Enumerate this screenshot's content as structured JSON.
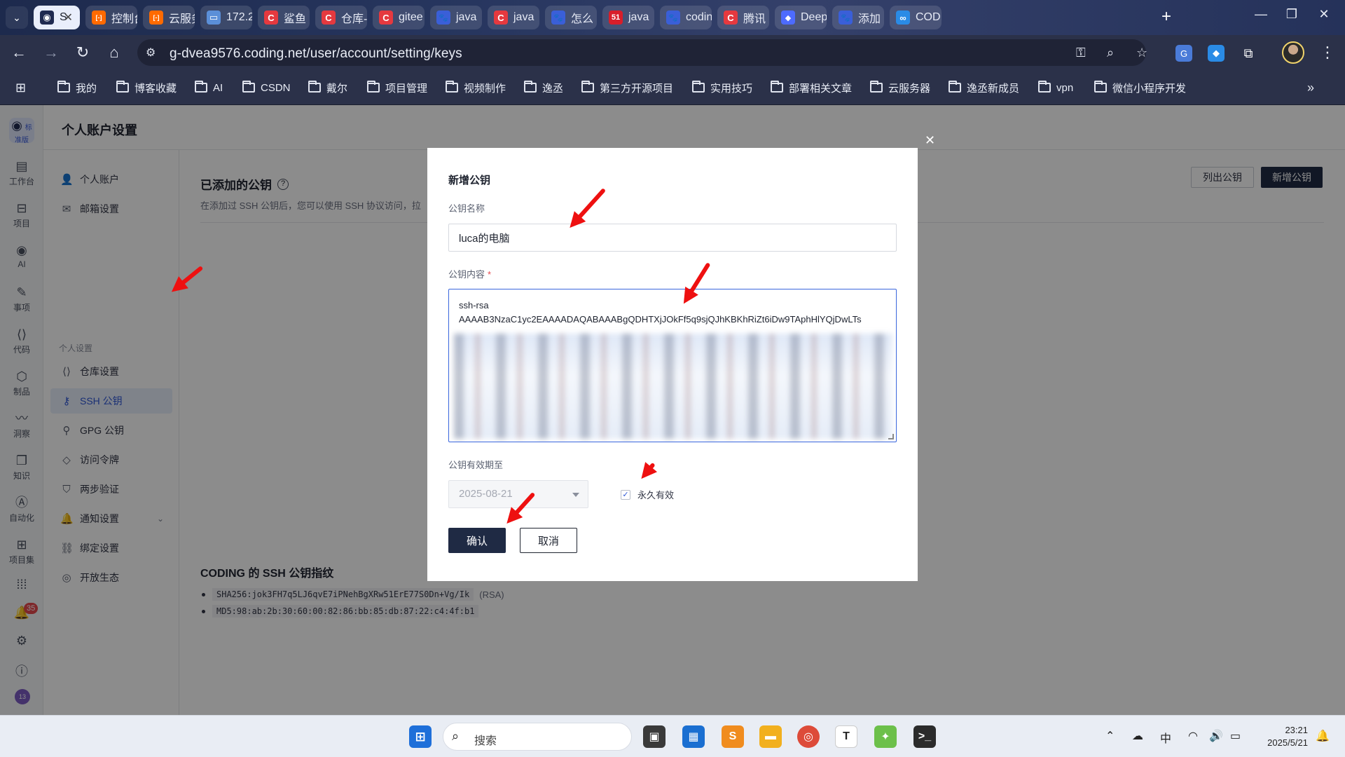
{
  "browser": {
    "tabs": [
      {
        "label": "S",
        "active": true,
        "icon_text": "",
        "icon_color": "#1f2a50"
      },
      {
        "label": "控制台",
        "icon_text": "[-]",
        "icon_color": "#ff6a00"
      },
      {
        "label": "云服务",
        "icon_text": "[-]",
        "icon_color": "#ff6a00"
      },
      {
        "label": "172.2",
        "icon_text": "▭",
        "icon_color": "#5b8fd8"
      },
      {
        "label": "鲨鱼",
        "icon_text": "C",
        "icon_color": "#e5393f"
      },
      {
        "label": "仓库-",
        "icon_text": "C",
        "icon_color": "#e5393f"
      },
      {
        "label": "gitee",
        "icon_text": "C",
        "icon_color": "#e5393f"
      },
      {
        "label": "java",
        "icon_text": "🐾",
        "icon_color": "#3a5fd8"
      },
      {
        "label": "java",
        "icon_text": "C",
        "icon_color": "#e5393f"
      },
      {
        "label": "怎么",
        "icon_text": "🐾",
        "icon_color": "#3a5fd8"
      },
      {
        "label": "java",
        "icon_text": "51",
        "icon_color": "#d81e2a"
      },
      {
        "label": "codin",
        "icon_text": "🐾",
        "icon_color": "#3a5fd8"
      },
      {
        "label": "腾讯",
        "icon_text": "C",
        "icon_color": "#e5393f"
      },
      {
        "label": "Deep",
        "icon_text": "◆",
        "icon_color": "#4d6bfe"
      },
      {
        "label": "添加",
        "icon_text": "🐾",
        "icon_color": "#3a5fd8"
      },
      {
        "label": "CODI",
        "icon_text": "∞",
        "icon_color": "#2a8be6"
      }
    ],
    "url": "g-dvea9576.coding.net/user/account/setting/keys",
    "bookmarks": [
      "我的",
      "博客收藏",
      "AI",
      "CSDN",
      "戴尔",
      "项目管理",
      "视频制作",
      "逸丞",
      "第三方开源项目",
      "实用技巧",
      "部署相关文章",
      "云服务器",
      "逸丞新成员",
      "vpn",
      "微信小程序开发"
    ]
  },
  "rail": {
    "logo_label": "标准版",
    "items": [
      {
        "label": "工作台",
        "icon": "▤"
      },
      {
        "label": "项目",
        "icon": "⊟"
      },
      {
        "label": "AI",
        "icon": "◉"
      },
      {
        "label": "事项",
        "icon": "✎"
      },
      {
        "label": "代码",
        "icon": "⟨⟩"
      },
      {
        "label": "制品",
        "icon": "⬡"
      },
      {
        "label": "洞察",
        "icon": "〰"
      },
      {
        "label": "知识",
        "icon": "❐"
      },
      {
        "label": "自动化",
        "icon": "Ⓐ"
      },
      {
        "label": "项目集",
        "icon": "⊞"
      }
    ],
    "notification_count": "35",
    "avatar_text": "13"
  },
  "page": {
    "title": "个人账户设置",
    "menu": {
      "top": [
        {
          "label": "个人账户",
          "icon": "👤"
        },
        {
          "label": "邮箱设置",
          "icon": "✉"
        }
      ],
      "group_label": "个人设置",
      "items": [
        {
          "label": "仓库设置",
          "icon": "⟨⟩"
        },
        {
          "label": "SSH 公钥",
          "icon": "⚷",
          "active": true
        },
        {
          "label": "GPG 公钥",
          "icon": "⚲"
        },
        {
          "label": "访问令牌",
          "icon": "◇"
        },
        {
          "label": "两步验证",
          "icon": "⛉"
        },
        {
          "label": "通知设置",
          "icon": "🔔",
          "has_chevron": true
        },
        {
          "label": "绑定设置",
          "icon": "⛓"
        },
        {
          "label": "开放生态",
          "icon": "◎"
        }
      ]
    },
    "section_title": "已添加的公钥",
    "section_desc": "在添加过 SSH 公钥后，您可以使用 SSH 协议访问，拉",
    "list_button": "列出公钥",
    "add_button": "新增公钥",
    "fingerprint_title": "CODING 的 SSH 公钥指纹",
    "fingerprints": [
      {
        "value": "SHA256:jok3FH7q5LJ6qvE7iPNehBgXRw51ErE77S0Dn+Vg/Ik",
        "tag": "(RSA)"
      },
      {
        "value": "MD5:98:ab:2b:30:60:00:82:86:bb:85:db:87:22:c4:4f:b1",
        "tag": ""
      }
    ]
  },
  "modal": {
    "title": "新增公钥",
    "name_label": "公钥名称",
    "name_value": "luca的电脑",
    "content_label": "公钥内容",
    "required_mark": "*",
    "content_line1": "ssh-rsa",
    "content_line2": "AAAAB3NzaC1yc2EAAAADAQABAAABgQDHTXjJOkFf5q9sjQJhKBKhRiZt6iDw9TAphHlYQjDwLTs",
    "expiry_label": "公钥有效期至",
    "expiry_value": "2025-08-21",
    "permanent_label": "永久有效",
    "permanent_checked": true,
    "confirm_label": "确认",
    "cancel_label": "取消"
  },
  "taskbar": {
    "search_placeholder": "搜索",
    "ime": "中",
    "time": "23:21",
    "date": "2025/5/21"
  },
  "colors": {
    "accent": "#2e57d6",
    "primary_button": "#1f2a44",
    "annotation_arrow": "#ee1010"
  }
}
